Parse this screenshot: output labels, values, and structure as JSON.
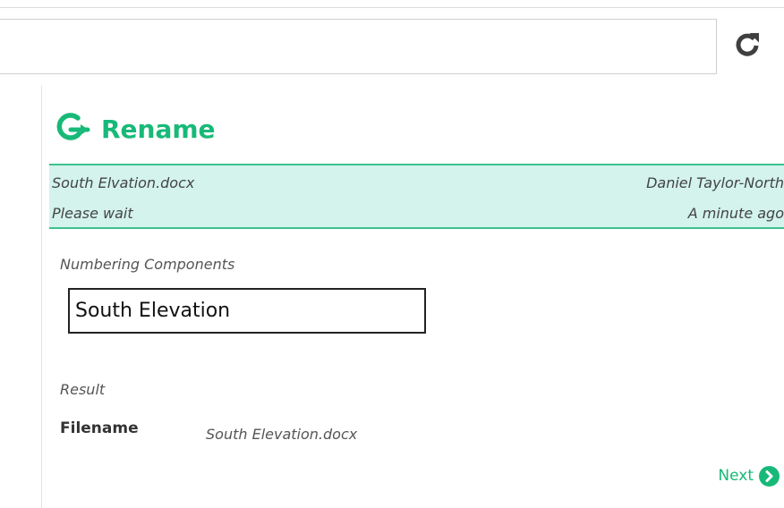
{
  "colors": {
    "accent": "#18b978",
    "info_background": "#d3f3ec",
    "info_border": "#3cc28f"
  },
  "browser": {
    "address_value": "",
    "refresh_icon": "refresh-icon"
  },
  "panel": {
    "logo_icon": "g-arrow-logo-icon",
    "title": "Rename"
  },
  "info": {
    "filename": "South Elvation.docx",
    "status": "Please wait",
    "author": "Daniel Taylor-North",
    "time": "A minute ago"
  },
  "form": {
    "components_label": "Numbering Components",
    "input_value": "South Elevation"
  },
  "result": {
    "label": "Result",
    "filename_key": "Filename",
    "filename_value": "South Elevation.docx"
  },
  "actions": {
    "next_label": "Next",
    "next_icon": "chevron-circle-right-icon"
  }
}
